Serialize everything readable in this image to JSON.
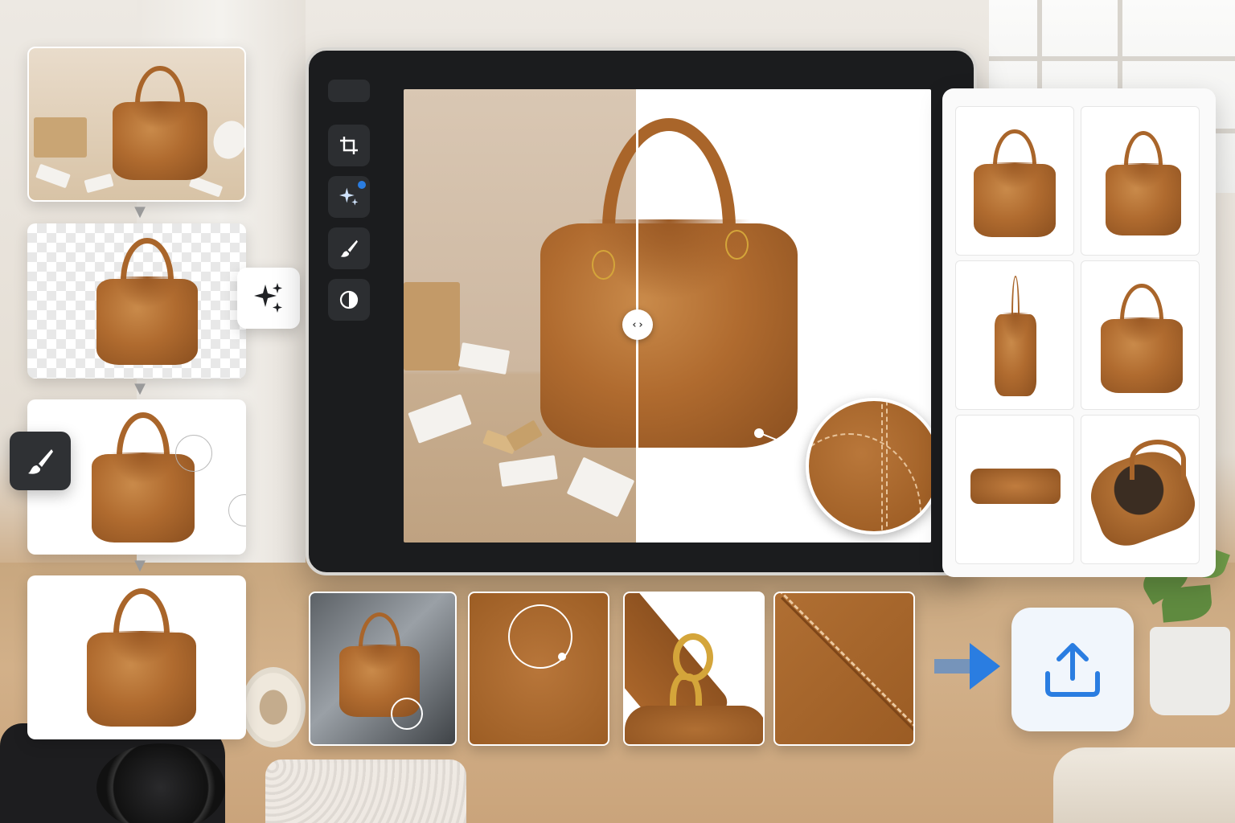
{
  "app": {
    "accent_color": "#2a7de1",
    "product_color": "#b06b2f"
  },
  "workflow_steps": [
    {
      "icon": "original-photo",
      "state": "original"
    },
    {
      "icon": "transparent-background",
      "state": "background-removed"
    },
    {
      "icon": "retouch",
      "state": "retouching"
    },
    {
      "icon": "final-image",
      "state": "final"
    }
  ],
  "floating_tools": {
    "ai_enhance_icon": "sparkle-icon",
    "retouch_icon": "brush-icon"
  },
  "editor": {
    "toolbar": [
      "crop-icon",
      "sparkle-icon",
      "brush-icon",
      "contrast-icon"
    ],
    "active_tool": "sparkle-icon",
    "compare_handle_glyph": "‹›"
  },
  "results": {
    "views": [
      "front-angled",
      "front-angled-alt",
      "side",
      "front",
      "bottom",
      "interior-open"
    ]
  },
  "details": {
    "crops": [
      "reflection-shot",
      "leather-texture",
      "hardware-ring",
      "stitching"
    ]
  },
  "export": {
    "icon": "upload-icon"
  }
}
